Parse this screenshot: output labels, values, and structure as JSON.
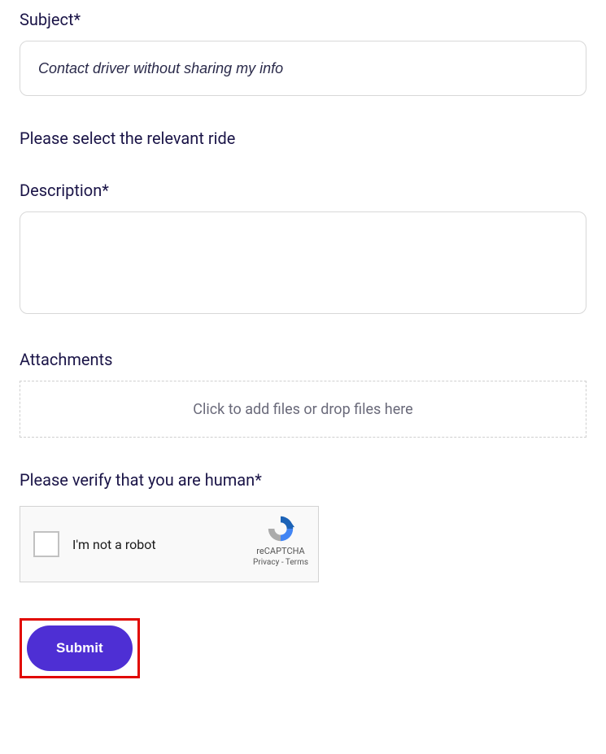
{
  "subject": {
    "label": "Subject*",
    "value": "Contact driver without sharing my info"
  },
  "ride_select": {
    "label": "Please select the relevant ride"
  },
  "description": {
    "label": "Description*",
    "value": ""
  },
  "attachments": {
    "label": "Attachments",
    "dropzone_text": "Click to add files or drop files here"
  },
  "captcha": {
    "label": "Please verify that you are human*",
    "checkbox_label": "I'm not a robot",
    "brand": "reCAPTCHA",
    "privacy": "Privacy",
    "terms": "Terms"
  },
  "submit": {
    "label": "Submit"
  }
}
